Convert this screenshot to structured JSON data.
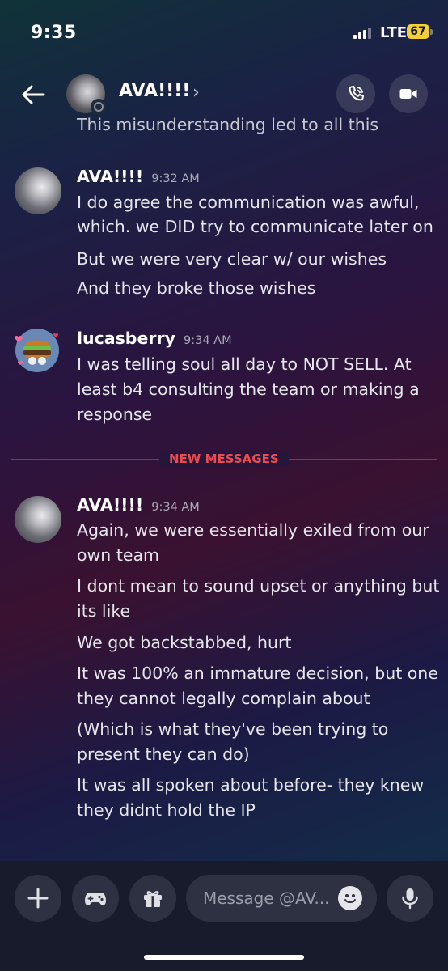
{
  "status_bar": {
    "time": "9:35",
    "network": "LTE",
    "battery": "67"
  },
  "header": {
    "contact_name": "AVA!!!!",
    "chevron": "›"
  },
  "messages": {
    "cut_off_line": "This misunderstanding led to all this",
    "group1": {
      "author": "AVA!!!!",
      "time": "9:32 AM",
      "lines": [
        "I do agree the communication was awful,",
        "which. we DID try to communicate later on",
        "But we were very clear w/ our wishes",
        "And they broke those wishes"
      ]
    },
    "group2": {
      "author": "lucasberry",
      "time": "9:34 AM",
      "lines": [
        "I was telling soul all day to NOT SELL. At",
        "least b4 consulting the team or making a",
        "response"
      ]
    },
    "new_messages_label": "NEW MESSAGES",
    "group3": {
      "author": "AVA!!!!",
      "time": "9:34 AM",
      "lines": [
        "Again, we were essentially exiled from our",
        "own team",
        "I dont mean to sound upset or anything but",
        "its like",
        "We got backstabbed, hurt",
        "It was 100% an immature decision, but one",
        "they cannot legally complain about",
        "(Which is what they've been trying to",
        "present they can do)",
        "It was all spoken about before- they knew",
        "they didnt hold the IP"
      ]
    }
  },
  "composer": {
    "placeholder": "Message @AV..."
  },
  "icons": [
    "back-arrow-icon",
    "phone-icon",
    "video-camera-icon",
    "plus-icon",
    "gamepad-icon",
    "gift-icon",
    "emoji-icon",
    "microphone-icon"
  ],
  "colors": {
    "accent_new": "#f0494f",
    "composer_bg": "#181b2b",
    "button_bg": "#2d3142"
  }
}
